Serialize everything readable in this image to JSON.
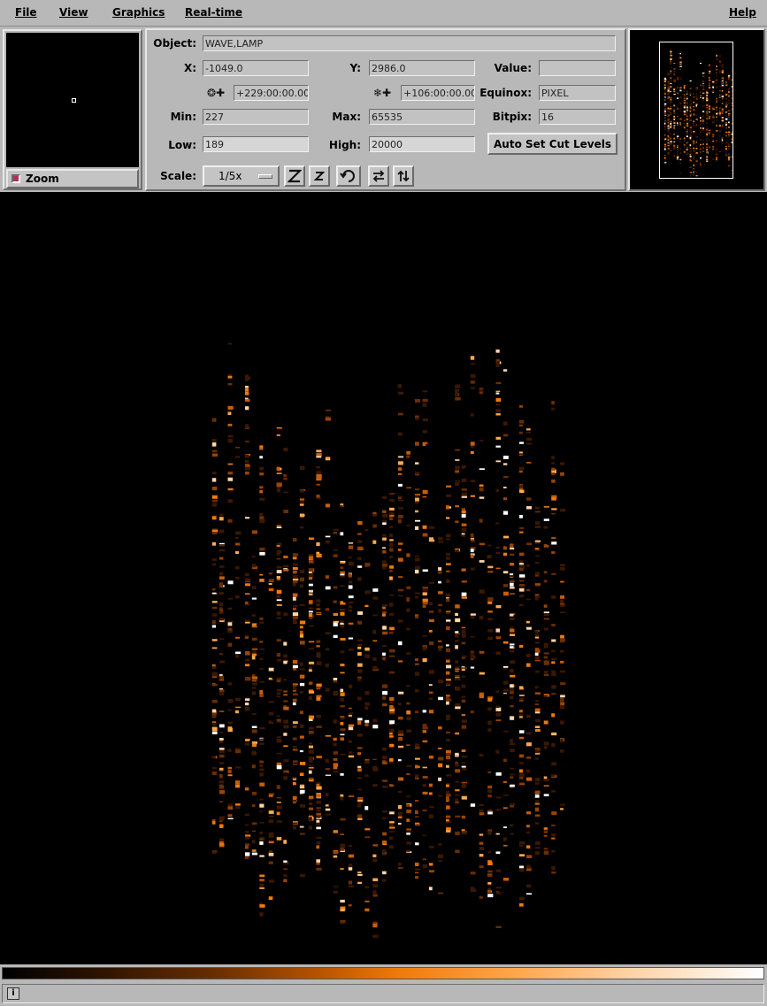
{
  "menu": {
    "file": "File",
    "view": "View",
    "graphics": "Graphics",
    "realtime": "Real-time",
    "help": "Help"
  },
  "zoom": {
    "label": "Zoom",
    "checked": true
  },
  "info": {
    "object_label": "Object:",
    "object_value": "WAVE,LAMP",
    "x_label": "X:",
    "x_value": "-1049.0",
    "y_label": "Y:",
    "y_value": "2986.0",
    "value_label": "Value:",
    "value_value": "",
    "ra_value": "+229:00:00.00",
    "dec_value": "+106:00:00.00",
    "equinox_label": "Equinox:",
    "equinox_value": "PIXEL",
    "min_label": "Min:",
    "min_value": "227",
    "max_label": "Max:",
    "max_value": "65535",
    "bitpix_label": "Bitpix:",
    "bitpix_value": "16",
    "low_label": "Low:",
    "low_value": "189",
    "high_label": "High:",
    "high_value": "20000",
    "auto_cut_label": "Auto Set Cut Levels",
    "scale_label": "Scale:",
    "scale_value": "1/5x"
  },
  "icons": {
    "ra_icon": "ra-axis-icon",
    "dec_icon": "dec-axis-icon",
    "zoom_in": "zoom-in-icon",
    "zoom_out": "zoom-out-icon",
    "rotate": "rotate-icon",
    "flip_x": "flip-x-icon",
    "flip_y": "flip-y-icon",
    "info": "info-icon"
  },
  "colorbar": {
    "colormap": "heat",
    "colors": [
      "#000000",
      "#6a2e00",
      "#f07a0a",
      "#ffd6ad",
      "#ffffff"
    ]
  },
  "status": {
    "icon_glyph": "i",
    "text": ""
  },
  "colors": {
    "panel_bg": "#b8b8b8",
    "image_bg": "#000000",
    "accent": "#f07a0a",
    "zoom_check": "#b03060"
  }
}
